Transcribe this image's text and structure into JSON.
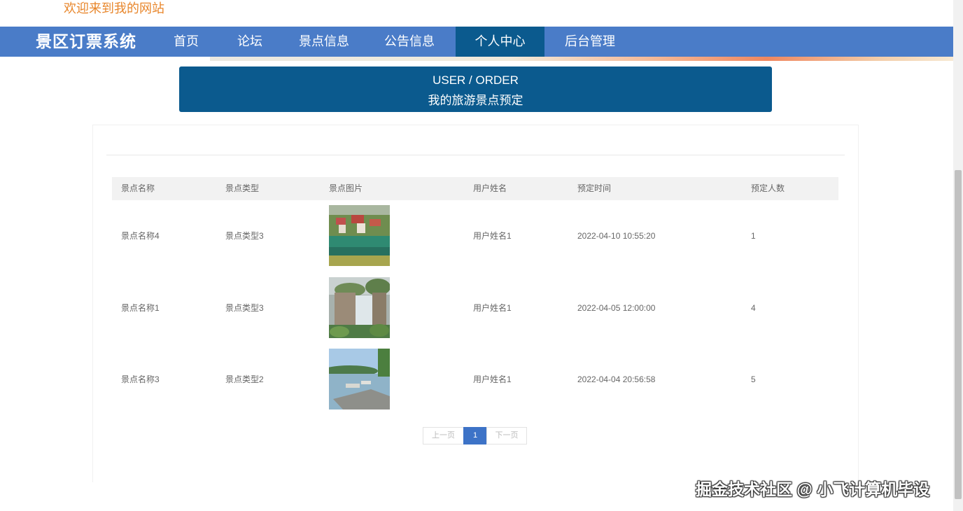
{
  "header": {
    "welcome": "欢迎来到我的网站"
  },
  "navbar": {
    "brand": "景区订票系统",
    "items": [
      {
        "label": "首页"
      },
      {
        "label": "论坛"
      },
      {
        "label": "景点信息"
      },
      {
        "label": "公告信息"
      },
      {
        "label": "个人中心",
        "active": true
      },
      {
        "label": "后台管理"
      }
    ]
  },
  "title_bar": {
    "en": "USER / ORDER",
    "zh": "我的旅游景点预定"
  },
  "table": {
    "headers": [
      "景点名称",
      "景点类型",
      "景点图片",
      "用户姓名",
      "预定时间",
      "预定人数"
    ],
    "rows": [
      {
        "name": "景点名称4",
        "type": "景点类型3",
        "image": "river-village-photo",
        "user": "用户姓名1",
        "time": "2022-04-10 10:55:20",
        "count": "1"
      },
      {
        "name": "景点名称1",
        "type": "景点类型3",
        "image": "waterfall-photo",
        "user": "用户姓名1",
        "time": "2022-04-05 12:00:00",
        "count": "4"
      },
      {
        "name": "景点名称3",
        "type": "景点类型2",
        "image": "lake-pier-photo",
        "user": "用户姓名1",
        "time": "2022-04-04 20:56:58",
        "count": "5"
      }
    ]
  },
  "pagination": {
    "prev": "上一页",
    "current": "1",
    "next": "下一页"
  },
  "watermark": "掘金技术社区 @ 小飞计算机毕设",
  "colors": {
    "nav": "#4a7cc8",
    "active_nav": "#0b5a8e",
    "welcome": "#e8862b",
    "page_current": "#3d73c7"
  }
}
